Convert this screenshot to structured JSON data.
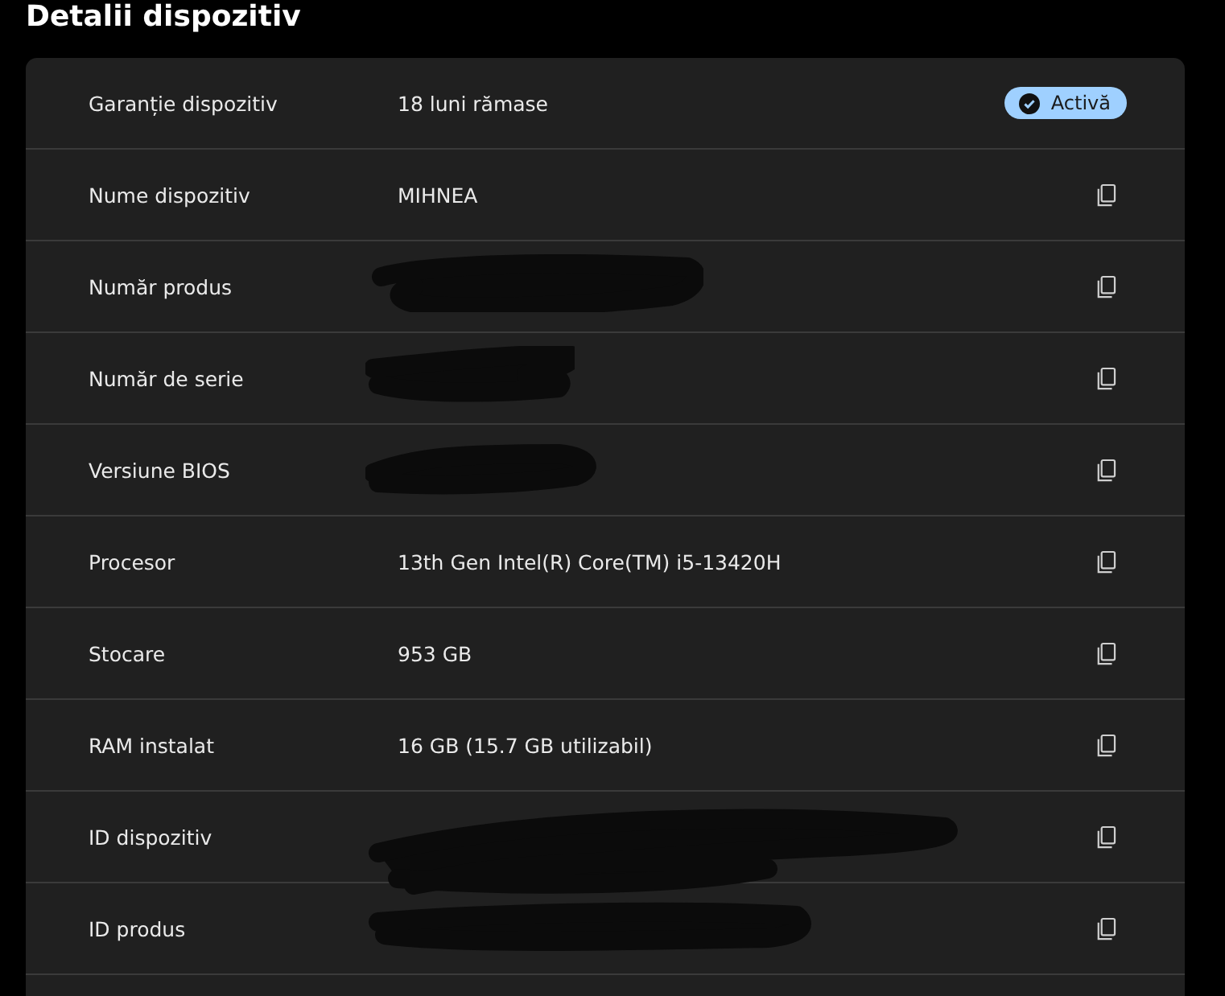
{
  "title": "Detalii dispozitiv",
  "rows": [
    {
      "label": "Garanție dispozitiv",
      "value": "18 luni rămase",
      "redacted": false,
      "action": {
        "kind": "badge",
        "text": "Activă",
        "active": true
      }
    },
    {
      "label": "Nume dispozitiv",
      "value": "MIHNEA",
      "redacted": false,
      "action": {
        "kind": "copy"
      }
    },
    {
      "label": "Număr produs",
      "redacted": true,
      "action": {
        "kind": "copy"
      }
    },
    {
      "label": "Număr de serie",
      "redacted": true,
      "action": {
        "kind": "copy"
      }
    },
    {
      "label": "Versiune BIOS",
      "redacted": true,
      "action": {
        "kind": "copy"
      }
    },
    {
      "label": "Procesor",
      "value": "13th Gen Intel(R) Core(TM) i5-13420H",
      "redacted": false,
      "action": {
        "kind": "copy"
      }
    },
    {
      "label": "Stocare",
      "value": "953 GB",
      "redacted": false,
      "action": {
        "kind": "copy"
      }
    },
    {
      "label": "RAM instalat",
      "value": "16 GB (15.7 GB utilizabil)",
      "redacted": false,
      "action": {
        "kind": "copy"
      }
    },
    {
      "label": "ID dispozitiv",
      "redacted": true,
      "action": {
        "kind": "copy"
      }
    },
    {
      "label": "ID produs",
      "redacted": true,
      "action": {
        "kind": "copy"
      }
    }
  ]
}
